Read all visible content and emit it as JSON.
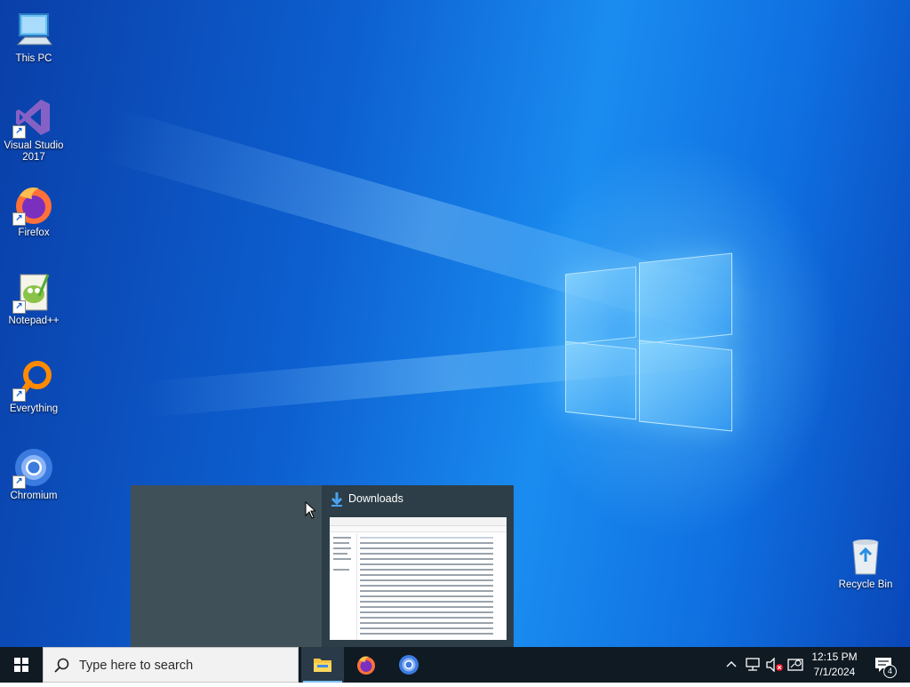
{
  "desktop": {
    "icons": [
      {
        "label": "This PC",
        "icon": "computer-icon"
      },
      {
        "label": "Visual Studio 2017",
        "icon": "visual-studio-icon"
      },
      {
        "label": "Firefox",
        "icon": "firefox-icon"
      },
      {
        "label": "Notepad++",
        "icon": "notepadpp-icon"
      },
      {
        "label": "Everything",
        "icon": "everything-search-icon"
      },
      {
        "label": "Chromium",
        "icon": "chromium-icon"
      }
    ],
    "recycle_bin": {
      "label": "Recycle Bin",
      "icon": "recycle-bin-icon"
    }
  },
  "thumbnail_popup": {
    "window_title": "Downloads",
    "icon": "download-arrow-icon"
  },
  "taskbar": {
    "search_placeholder": "Type here to search",
    "pinned": [
      {
        "name": "File Explorer",
        "icon": "file-explorer-icon",
        "active": true
      },
      {
        "name": "Firefox",
        "icon": "firefox-icon",
        "active": false
      },
      {
        "name": "Chromium",
        "icon": "chromium-icon",
        "active": false
      }
    ],
    "tray": {
      "icons": [
        "chevron-up-icon",
        "network-icon",
        "volume-muted-icon",
        "security-icon"
      ],
      "time": "12:15 PM",
      "date": "7/1/2024",
      "notification_count": "4"
    }
  },
  "colors": {
    "taskbar": "#101a23",
    "accent": "#7ec2f5",
    "desktop": "#0d5fd0"
  }
}
